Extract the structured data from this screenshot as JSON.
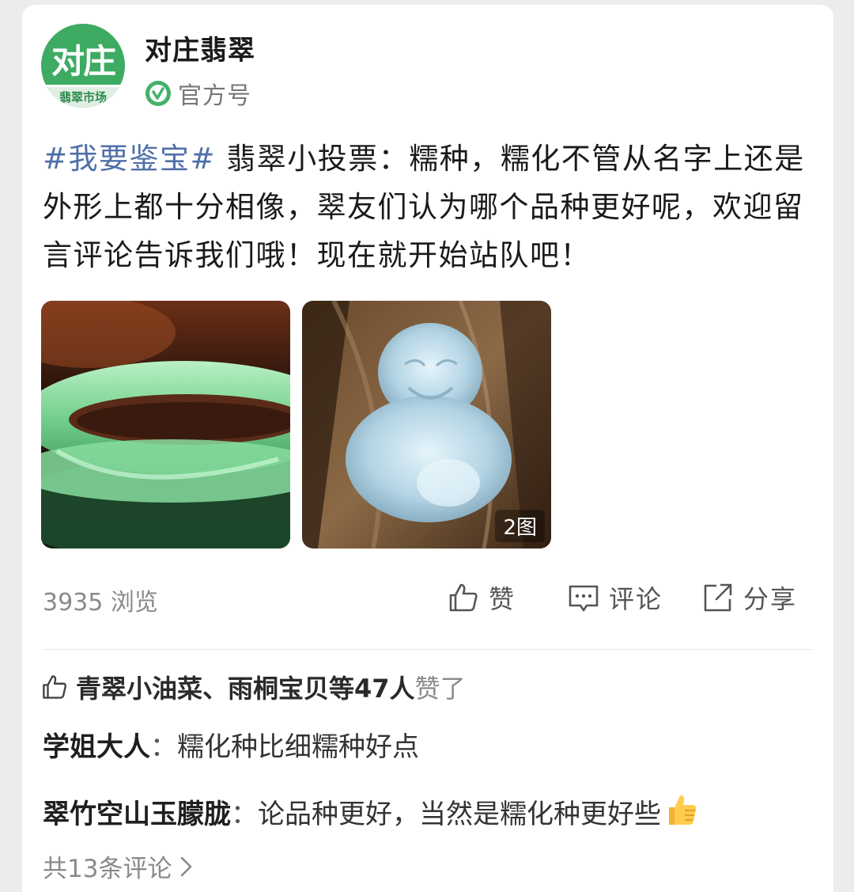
{
  "account": {
    "name": "对庄翡翠",
    "avatar_text_main": "对庄",
    "avatar_text_sub": "翡翠市场",
    "verified_label": "官方号"
  },
  "post": {
    "hashtag": "#我要鉴宝#",
    "text": " 翡翠小投票：糯种，糯化不管从名字上还是外形上都十分相像，翠友们认为哪个品种更好呢，欢迎留言评论告诉我们哦！现在就开始站队吧！",
    "image_count_label": "2图"
  },
  "stats": {
    "views": "3935 浏览",
    "like_label": "赞",
    "comment_label": "评论",
    "share_label": "分享"
  },
  "likes": {
    "names": "青翠小油菜、雨桐宝贝等47人",
    "suffix": "赞了"
  },
  "comments": [
    {
      "author": "学姐大人",
      "text": "糯化种比细糯种好点"
    },
    {
      "author": "翠竹空山玉朦胧",
      "text": "论品种更好，当然是糯化种更好些"
    }
  ],
  "all_comments_label": "共13条评论",
  "colors": {
    "brand_green": "#3dab62",
    "hashtag_blue": "#4f6fa8",
    "muted_gray": "#8a8a8a"
  }
}
